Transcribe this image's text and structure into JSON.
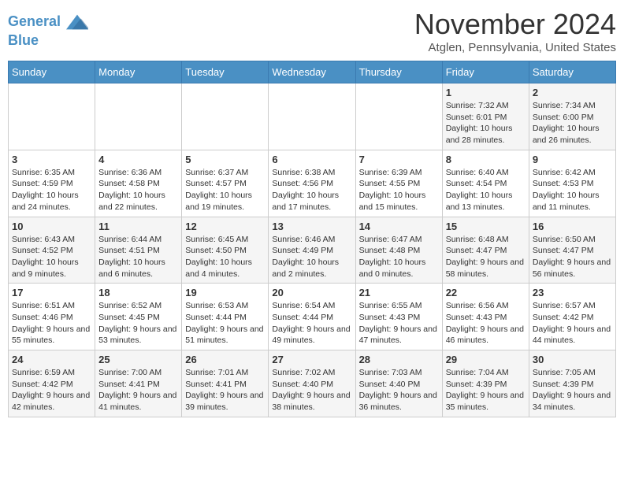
{
  "header": {
    "logo_line1": "General",
    "logo_line2": "Blue",
    "month_title": "November 2024",
    "location": "Atglen, Pennsylvania, United States"
  },
  "weekdays": [
    "Sunday",
    "Monday",
    "Tuesday",
    "Wednesday",
    "Thursday",
    "Friday",
    "Saturday"
  ],
  "weeks": [
    [
      {
        "day": "",
        "info": ""
      },
      {
        "day": "",
        "info": ""
      },
      {
        "day": "",
        "info": ""
      },
      {
        "day": "",
        "info": ""
      },
      {
        "day": "",
        "info": ""
      },
      {
        "day": "1",
        "info": "Sunrise: 7:32 AM\nSunset: 6:01 PM\nDaylight: 10 hours and 28 minutes."
      },
      {
        "day": "2",
        "info": "Sunrise: 7:34 AM\nSunset: 6:00 PM\nDaylight: 10 hours and 26 minutes."
      }
    ],
    [
      {
        "day": "3",
        "info": "Sunrise: 6:35 AM\nSunset: 4:59 PM\nDaylight: 10 hours and 24 minutes."
      },
      {
        "day": "4",
        "info": "Sunrise: 6:36 AM\nSunset: 4:58 PM\nDaylight: 10 hours and 22 minutes."
      },
      {
        "day": "5",
        "info": "Sunrise: 6:37 AM\nSunset: 4:57 PM\nDaylight: 10 hours and 19 minutes."
      },
      {
        "day": "6",
        "info": "Sunrise: 6:38 AM\nSunset: 4:56 PM\nDaylight: 10 hours and 17 minutes."
      },
      {
        "day": "7",
        "info": "Sunrise: 6:39 AM\nSunset: 4:55 PM\nDaylight: 10 hours and 15 minutes."
      },
      {
        "day": "8",
        "info": "Sunrise: 6:40 AM\nSunset: 4:54 PM\nDaylight: 10 hours and 13 minutes."
      },
      {
        "day": "9",
        "info": "Sunrise: 6:42 AM\nSunset: 4:53 PM\nDaylight: 10 hours and 11 minutes."
      }
    ],
    [
      {
        "day": "10",
        "info": "Sunrise: 6:43 AM\nSunset: 4:52 PM\nDaylight: 10 hours and 9 minutes."
      },
      {
        "day": "11",
        "info": "Sunrise: 6:44 AM\nSunset: 4:51 PM\nDaylight: 10 hours and 6 minutes."
      },
      {
        "day": "12",
        "info": "Sunrise: 6:45 AM\nSunset: 4:50 PM\nDaylight: 10 hours and 4 minutes."
      },
      {
        "day": "13",
        "info": "Sunrise: 6:46 AM\nSunset: 4:49 PM\nDaylight: 10 hours and 2 minutes."
      },
      {
        "day": "14",
        "info": "Sunrise: 6:47 AM\nSunset: 4:48 PM\nDaylight: 10 hours and 0 minutes."
      },
      {
        "day": "15",
        "info": "Sunrise: 6:48 AM\nSunset: 4:47 PM\nDaylight: 9 hours and 58 minutes."
      },
      {
        "day": "16",
        "info": "Sunrise: 6:50 AM\nSunset: 4:47 PM\nDaylight: 9 hours and 56 minutes."
      }
    ],
    [
      {
        "day": "17",
        "info": "Sunrise: 6:51 AM\nSunset: 4:46 PM\nDaylight: 9 hours and 55 minutes."
      },
      {
        "day": "18",
        "info": "Sunrise: 6:52 AM\nSunset: 4:45 PM\nDaylight: 9 hours and 53 minutes."
      },
      {
        "day": "19",
        "info": "Sunrise: 6:53 AM\nSunset: 4:44 PM\nDaylight: 9 hours and 51 minutes."
      },
      {
        "day": "20",
        "info": "Sunrise: 6:54 AM\nSunset: 4:44 PM\nDaylight: 9 hours and 49 minutes."
      },
      {
        "day": "21",
        "info": "Sunrise: 6:55 AM\nSunset: 4:43 PM\nDaylight: 9 hours and 47 minutes."
      },
      {
        "day": "22",
        "info": "Sunrise: 6:56 AM\nSunset: 4:43 PM\nDaylight: 9 hours and 46 minutes."
      },
      {
        "day": "23",
        "info": "Sunrise: 6:57 AM\nSunset: 4:42 PM\nDaylight: 9 hours and 44 minutes."
      }
    ],
    [
      {
        "day": "24",
        "info": "Sunrise: 6:59 AM\nSunset: 4:42 PM\nDaylight: 9 hours and 42 minutes."
      },
      {
        "day": "25",
        "info": "Sunrise: 7:00 AM\nSunset: 4:41 PM\nDaylight: 9 hours and 41 minutes."
      },
      {
        "day": "26",
        "info": "Sunrise: 7:01 AM\nSunset: 4:41 PM\nDaylight: 9 hours and 39 minutes."
      },
      {
        "day": "27",
        "info": "Sunrise: 7:02 AM\nSunset: 4:40 PM\nDaylight: 9 hours and 38 minutes."
      },
      {
        "day": "28",
        "info": "Sunrise: 7:03 AM\nSunset: 4:40 PM\nDaylight: 9 hours and 36 minutes."
      },
      {
        "day": "29",
        "info": "Sunrise: 7:04 AM\nSunset: 4:39 PM\nDaylight: 9 hours and 35 minutes."
      },
      {
        "day": "30",
        "info": "Sunrise: 7:05 AM\nSunset: 4:39 PM\nDaylight: 9 hours and 34 minutes."
      }
    ]
  ]
}
